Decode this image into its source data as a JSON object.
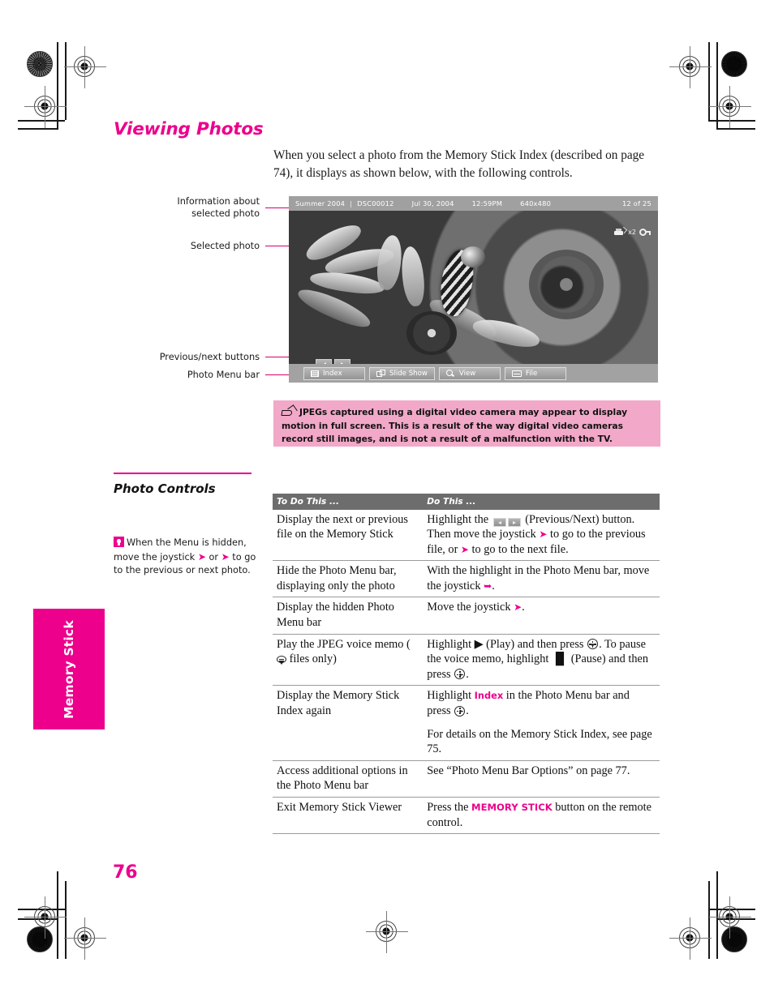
{
  "page": {
    "number": "76",
    "side_tab": "Memory Stick"
  },
  "heading": {
    "title": "Viewing Photos",
    "intro": "When you select a photo from the Memory Stick Index (described on page 74), it displays as shown below, with the following controls."
  },
  "callouts": [
    {
      "id": "info-about-selected-photo",
      "line1": "Information about",
      "line2": "selected photo"
    },
    {
      "id": "selected-photo",
      "line1": "Selected photo",
      "line2": ""
    },
    {
      "id": "previous-next-buttons",
      "line1": "Previous/next buttons",
      "line2": ""
    },
    {
      "id": "photo-menu-bar",
      "line1": "Photo Menu bar",
      "line2": ""
    }
  ],
  "tv_screen": {
    "info_bar": {
      "album": "Summer 2004",
      "separator": "|",
      "filename": "DSC00012",
      "date": "Jul  30, 2004",
      "time": "12:59PM",
      "resolution": "640x480",
      "counter": "12 of 25"
    },
    "overlay_icons": {
      "print_icon": "print-icon",
      "print_count": "x2",
      "lock_icon": "key-lock-icon"
    },
    "prev_next": {
      "previous_label": "◀",
      "next_label": "▶"
    },
    "menu_bar": [
      {
        "icon": "grid-icon",
        "label": "Index"
      },
      {
        "icon": "slides-icon",
        "label": "Slide Show"
      },
      {
        "icon": "magnifier-icon",
        "label": "View"
      },
      {
        "icon": "file-icon",
        "label": "File"
      }
    ]
  },
  "note": {
    "icon": "pencil-note-icon",
    "text": "JPEGs captured using a digital video camera may appear to display motion in full screen. This is a result of the way digital video cameras record still images, and is not a result of a malfunction with the TV.",
    "bg_color": "#f2a8c8"
  },
  "section": {
    "title": "Photo Controls",
    "tip": {
      "icon": "lightbulb-tip-icon",
      "part1": "When the Menu is hidden, move the joystick ",
      "arrow_left": "←",
      "mid": " or ",
      "arrow_right": "→",
      "part2": " to go to the previous or next photo."
    }
  },
  "table": {
    "headers": {
      "col1": "To Do This ...",
      "col2": "Do This ..."
    },
    "rows": [
      {
        "do_this": "Display the next or previous file on the Memory Stick",
        "action_pre": "Highlight the ",
        "action_post": " (Previous/Next) button. Then move the joystick ",
        "action_mid": " to go to the previous file, or ",
        "action_end": " to go to the next file.",
        "kind": "prevnext"
      },
      {
        "do_this": "Hide the Photo Menu bar, displaying only the photo",
        "action_pre": "With the highlight in the Photo Menu bar, move the joystick ",
        "action_end": ".",
        "kind": "arrow-down"
      },
      {
        "do_this": "Display the hidden Photo Menu bar",
        "action_pre": "Move the joystick ",
        "action_end": ".",
        "kind": "arrow-up"
      },
      {
        "do_this_pre": "Play the JPEG voice memo (",
        "do_this_post": " files only)",
        "action_pre": "Highlight ▶ (Play) and then press ",
        "action_mid": ". To pause the voice memo, highlight ▐▌ (Pause) and then press ",
        "action_end": ".",
        "kind": "voice-memo"
      },
      {
        "do_this": "Display the Memory Stick Index again",
        "action_pre": "Highlight ",
        "action_link": "Index",
        "action_mid": " in the Photo Menu bar and press ",
        "action_end": ".",
        "action_para2": "For details on the Memory Stick Index, see page 75.",
        "kind": "index"
      },
      {
        "do_this": "Access additional options in the Photo Menu bar",
        "action_pre": "See “Photo Menu Bar Options” on page 77.",
        "kind": "plain"
      },
      {
        "do_this": "Exit Memory Stick Viewer",
        "action_pre": "Press the ",
        "action_link": "MEMORY STICK",
        "action_end": " button on the remote control.",
        "kind": "exit"
      }
    ]
  },
  "colors": {
    "accent_magenta": "#ec008c",
    "note_pink": "#f2a8c8",
    "table_header_gray": "#6d6d6d"
  }
}
